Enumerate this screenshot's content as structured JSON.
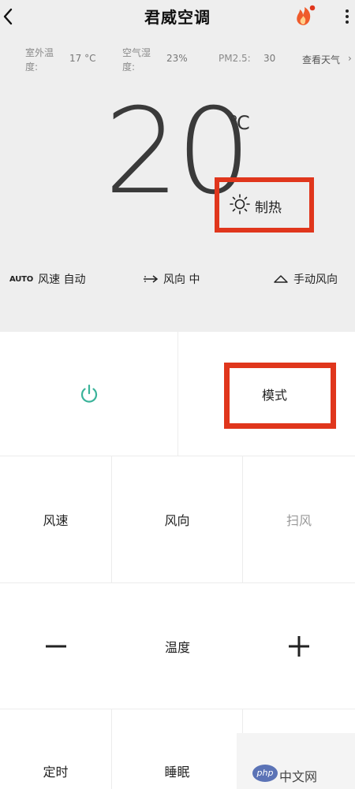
{
  "header": {
    "title": "君威空调",
    "back_icon": "chevron-left-icon",
    "fire_icon": "fire-icon",
    "more_icon": "more-vertical-icon",
    "accent_color": "#e0361c"
  },
  "weather": {
    "outdoor_temp_label": "室外温度:",
    "outdoor_temp_value": "17 °C",
    "humidity_label": "空气湿度:",
    "humidity_value": "23%",
    "pm25_label": "PM2.5:",
    "pm25_value": "30",
    "link_text": "查看天气",
    "link_arrow": "›"
  },
  "display": {
    "temperature": "20",
    "unit": "℃",
    "mode_icon": "sun-icon",
    "mode_label": "制热"
  },
  "status_row": {
    "auto_text": "AUTO",
    "fan_speed": "风速 自动",
    "wind_direction": "风向 中",
    "manual_direction": "手动风向"
  },
  "controls": {
    "power_icon": "power-icon",
    "power_color": "#3bb39a",
    "mode": "模式",
    "fan_speed": "风速",
    "wind_dir": "风向",
    "sweep": "扫风",
    "minus": "—",
    "temperature": "温度",
    "plus": "+",
    "timer": "定时",
    "sleep": "睡眠"
  },
  "watermark": {
    "logo": "php",
    "text": "中文网"
  }
}
